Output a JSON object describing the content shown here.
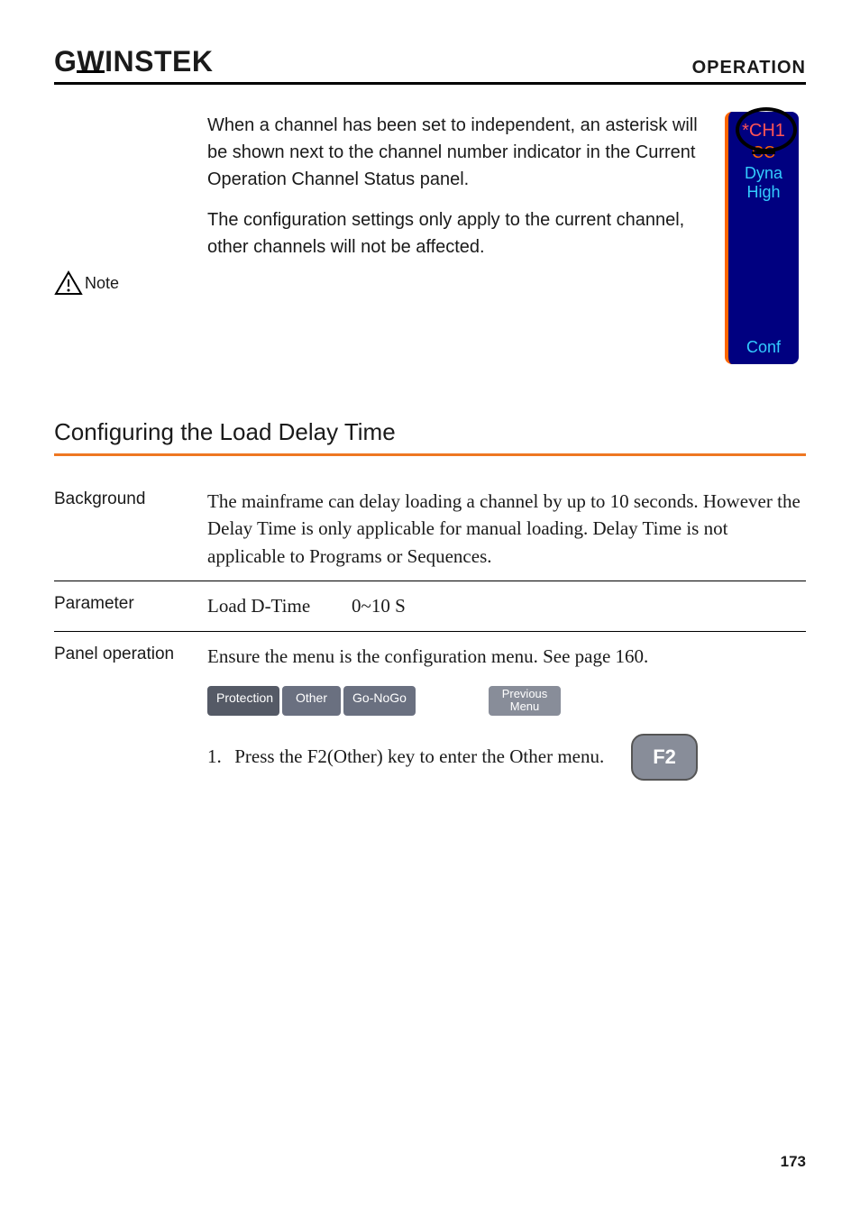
{
  "header": {
    "logo_part1": "G",
    "logo_part2": "W",
    "logo_part3": "INSTEK",
    "title": "OPERATION"
  },
  "note": {
    "label": "Note",
    "para1": "When a channel has been set to independent, an asterisk will be shown next to the channel number indicator in the Current Operation Channel Status panel.",
    "para2": "The configuration settings only apply to the current channel, other channels will not be affected."
  },
  "status_panel": {
    "channel": "*CH1",
    "mode": "CC",
    "dyna": "Dyna",
    "high": "High",
    "conf": "Conf"
  },
  "section": {
    "heading": "Configuring the Load Delay Time"
  },
  "background": {
    "label": "Background",
    "text": "The mainframe can delay loading a channel by up to 10 seconds. However the Delay Time is only applicable for manual loading. Delay Time is not applicable to Programs or Sequences."
  },
  "parameter": {
    "label": "Parameter",
    "name": "Load D-Time",
    "range": "0~10 S"
  },
  "panel_op": {
    "label": "Panel operation",
    "intro": "Ensure the menu is the configuration menu. See page 160.",
    "tabs": {
      "protection": "Protection",
      "other": "Other",
      "gonogo": "Go-NoGo",
      "previous": "Previous Menu"
    },
    "step1_num": "1.",
    "step1_text": "Press the F2(Other) key to enter the Other menu.",
    "f2_label": "F2"
  },
  "page_num": "173"
}
